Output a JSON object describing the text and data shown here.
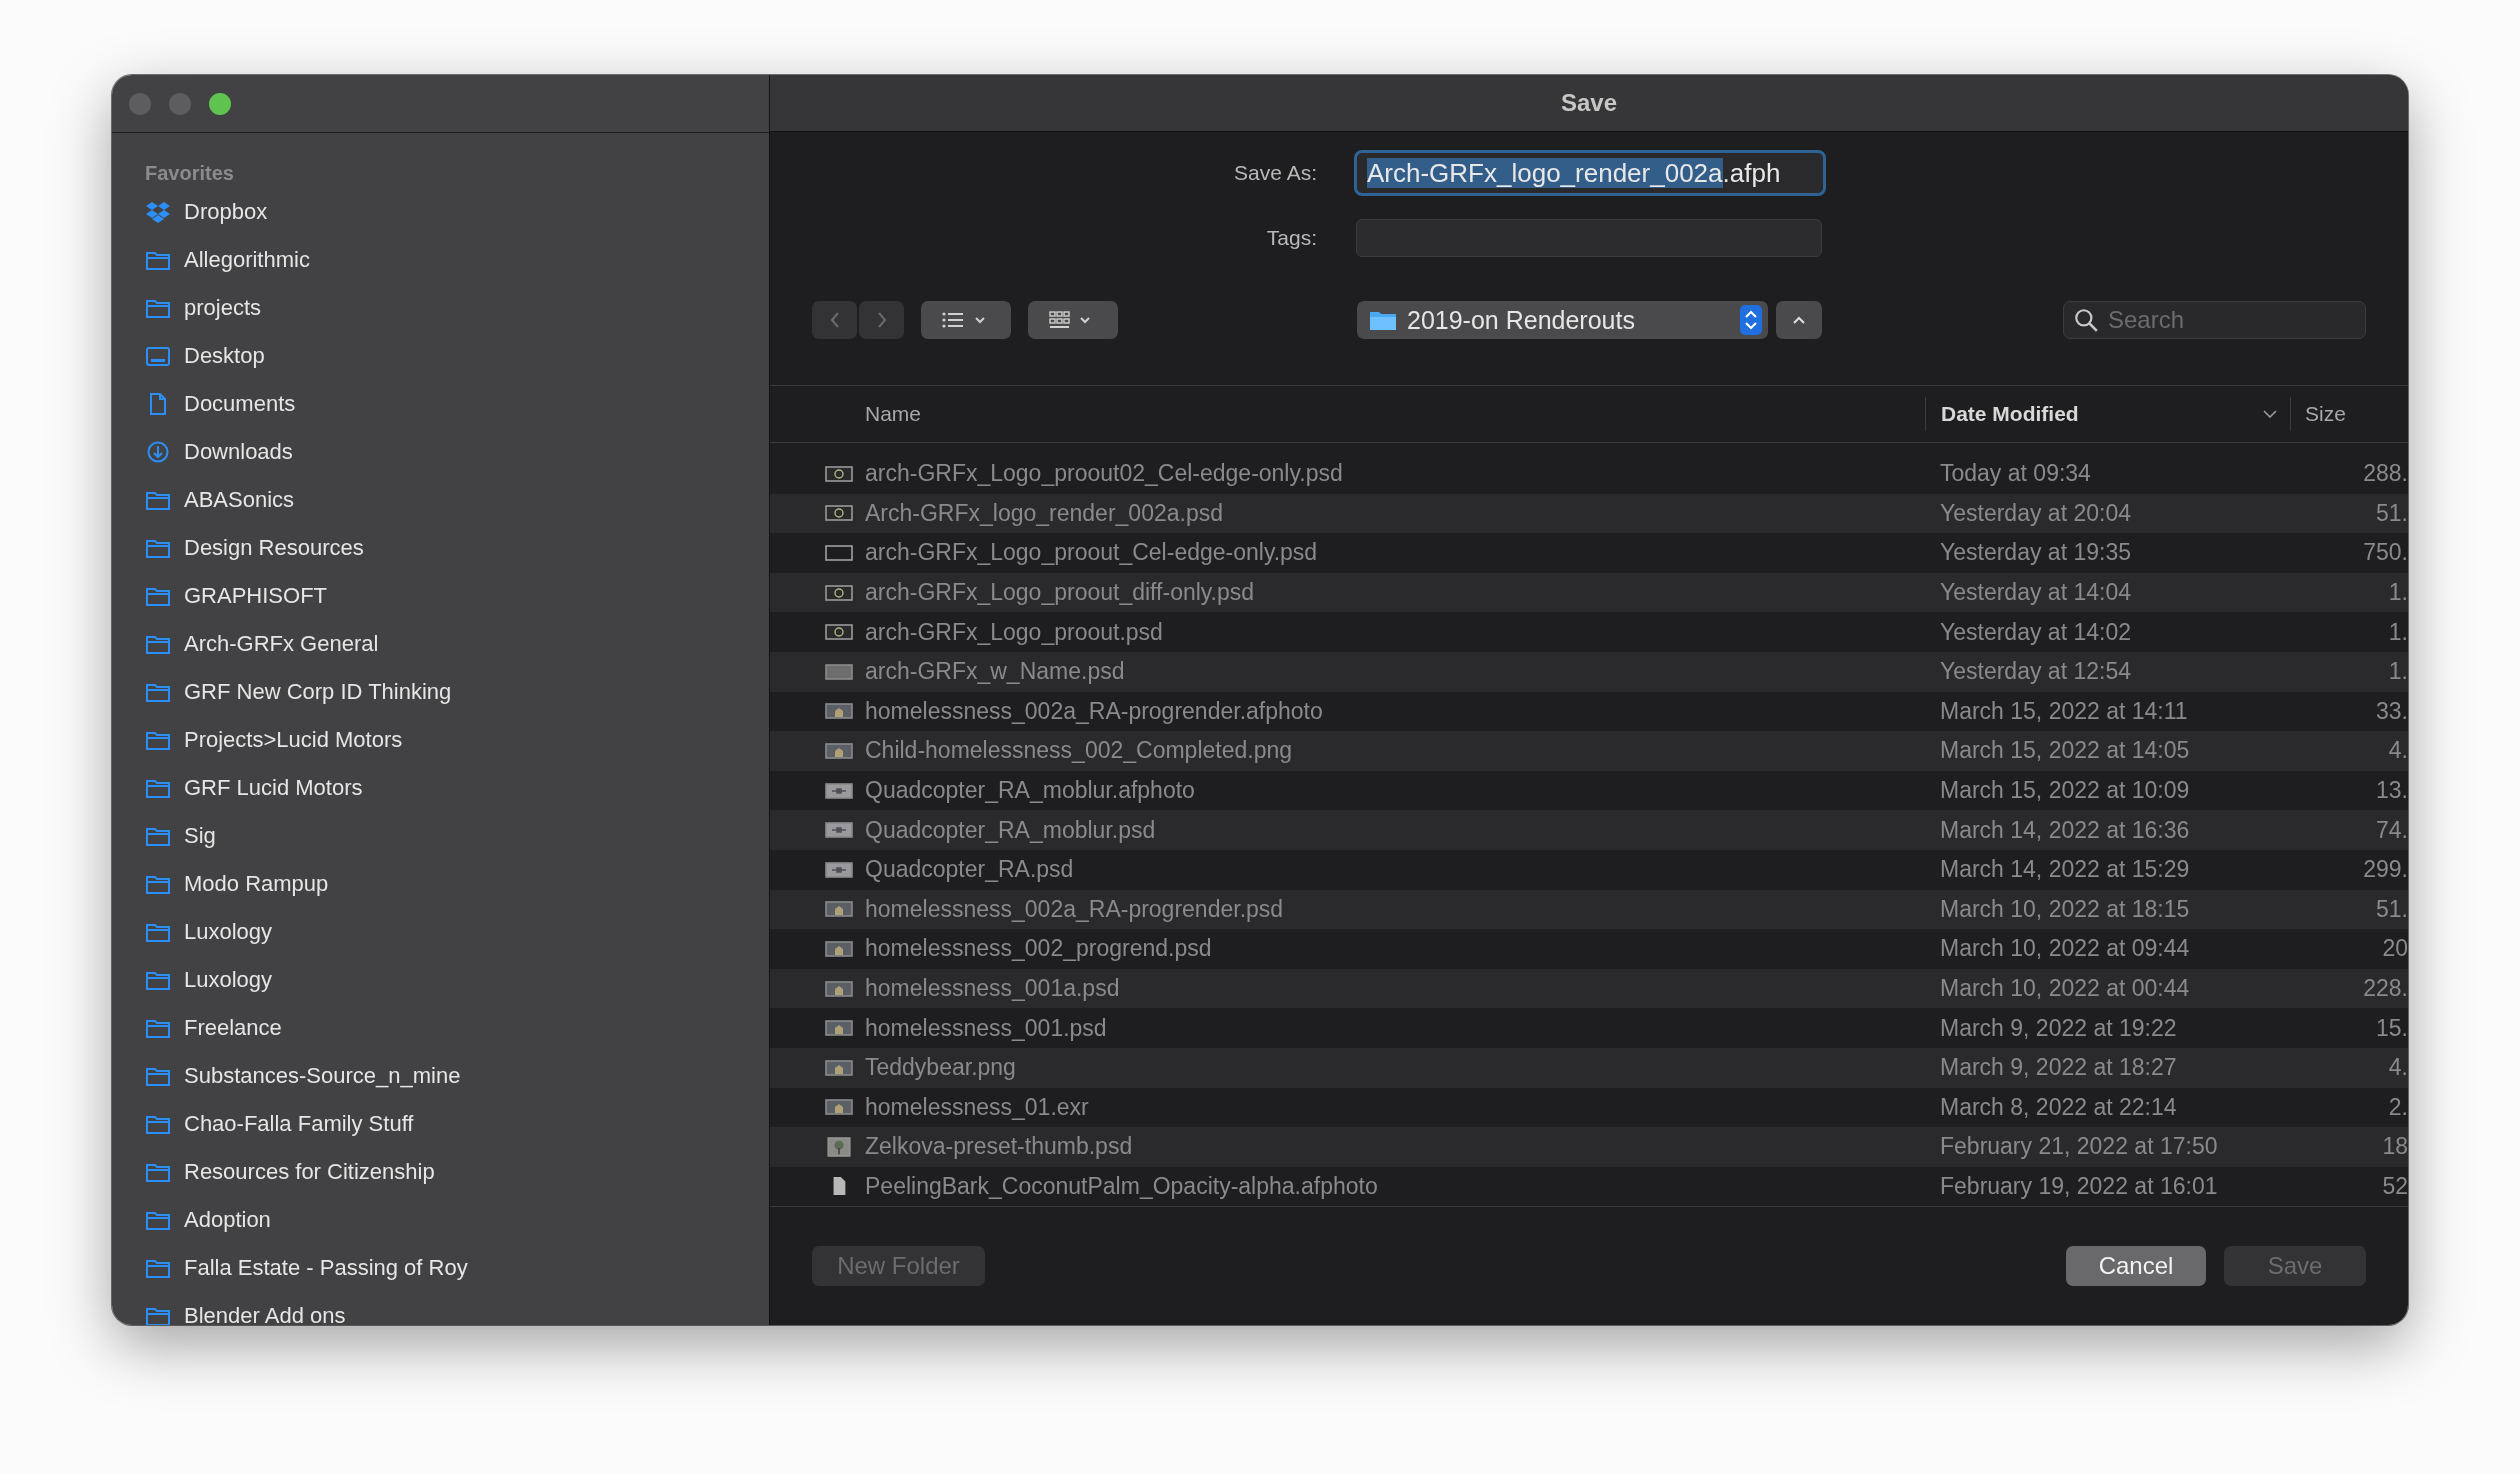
{
  "window": {
    "title": "Save",
    "controls": [
      {
        "color": "#5d5d5f"
      },
      {
        "color": "#5d5d5f"
      },
      {
        "color": "#5fc350"
      }
    ]
  },
  "sidebar": {
    "heading": "Favorites",
    "items": [
      {
        "label": "Dropbox",
        "kind": "dropbox"
      },
      {
        "label": "Allegorithmic",
        "kind": "folder"
      },
      {
        "label": "projects",
        "kind": "folder"
      },
      {
        "label": "Desktop",
        "kind": "desktop"
      },
      {
        "label": "Documents",
        "kind": "document"
      },
      {
        "label": "Downloads",
        "kind": "download"
      },
      {
        "label": "ABASonics",
        "kind": "folder"
      },
      {
        "label": "Design Resources",
        "kind": "folder"
      },
      {
        "label": "GRAPHISOFT",
        "kind": "folder"
      },
      {
        "label": "Arch-GRFx General",
        "kind": "folder"
      },
      {
        "label": "GRF New Corp ID Thinking",
        "kind": "folder"
      },
      {
        "label": "Projects>Lucid Motors",
        "kind": "folder"
      },
      {
        "label": "GRF Lucid Motors",
        "kind": "folder"
      },
      {
        "label": "Sig",
        "kind": "folder"
      },
      {
        "label": "Modo Rampup",
        "kind": "folder"
      },
      {
        "label": "Luxology",
        "kind": "folder"
      },
      {
        "label": "Luxology",
        "kind": "folder"
      },
      {
        "label": "Freelance",
        "kind": "folder"
      },
      {
        "label": "Substances-Source_n_mine",
        "kind": "folder"
      },
      {
        "label": "Chao-Falla Family Stuff",
        "kind": "folder"
      },
      {
        "label": "Resources for Citizenship",
        "kind": "folder"
      },
      {
        "label": "Adoption",
        "kind": "folder"
      },
      {
        "label": "Falla Estate - Passing of Roy",
        "kind": "folder"
      },
      {
        "label": "Blender Add ons",
        "kind": "folder"
      }
    ]
  },
  "form": {
    "save_as": {
      "label": "Save As:",
      "selected_text": "Arch-GRFx_logo_render_002a",
      "rest": ".afph"
    },
    "tags": {
      "label": "Tags:"
    }
  },
  "toolbar": {
    "location": "2019-on Renderouts",
    "search": {
      "placeholder": "Search"
    }
  },
  "table": {
    "columns": [
      {
        "label": "Name",
        "sorted": false
      },
      {
        "label": "Date Modified",
        "sorted": true
      },
      {
        "label": "Size",
        "sorted": false
      }
    ],
    "rows": [
      {
        "name": "arch-GRFx_Logo_proout02_Cel-edge-only.psd",
        "date": "Today at 09:34",
        "size": "288.",
        "kind": "logo"
      },
      {
        "name": "Arch-GRFx_logo_render_002a.psd",
        "date": "Yesterday at 20:04",
        "size": "51.",
        "kind": "logo"
      },
      {
        "name": "arch-GRFx_Logo_proout_Cel-edge-only.psd",
        "date": "Yesterday at 19:35",
        "size": "750.",
        "kind": "blank"
      },
      {
        "name": "arch-GRFx_Logo_proout_diff-only.psd",
        "date": "Yesterday at 14:04",
        "size": "1.",
        "kind": "logo"
      },
      {
        "name": "arch-GRFx_Logo_proout.psd",
        "date": "Yesterday at 14:02",
        "size": "1.",
        "kind": "logo"
      },
      {
        "name": "arch-GRFx_w_Name.psd",
        "date": "Yesterday at 12:54",
        "size": "1.",
        "kind": "plain"
      },
      {
        "name": "homelessness_002a_RA-progrender.afphoto",
        "date": "March 15, 2022 at 14:11",
        "size": "33.",
        "kind": "scene"
      },
      {
        "name": "Child-homelessness_002_Completed.png",
        "date": "March 15, 2022 at 14:05",
        "size": "4.",
        "kind": "scene"
      },
      {
        "name": "Quadcopter_RA_moblur.afphoto",
        "date": "March 15, 2022 at 10:09",
        "size": "13.",
        "kind": "drone"
      },
      {
        "name": "Quadcopter_RA_moblur.psd",
        "date": "March 14, 2022 at 16:36",
        "size": "74.",
        "kind": "drone"
      },
      {
        "name": "Quadcopter_RA.psd",
        "date": "March 14, 2022 at 15:29",
        "size": "299.",
        "kind": "drone"
      },
      {
        "name": "homelessness_002a_RA-progrender.psd",
        "date": "March 10, 2022 at 18:15",
        "size": "51.",
        "kind": "scene"
      },
      {
        "name": "homelessness_002_progrend.psd",
        "date": "March 10, 2022 at 09:44",
        "size": "20",
        "kind": "scene"
      },
      {
        "name": "homelessness_001a.psd",
        "date": "March 10, 2022 at 00:44",
        "size": "228.",
        "kind": "scene"
      },
      {
        "name": "homelessness_001.psd",
        "date": "March 9, 2022 at 19:22",
        "size": "15.",
        "kind": "scene"
      },
      {
        "name": "Teddybear.png",
        "date": "March 9, 2022 at 18:27",
        "size": "4.",
        "kind": "scene"
      },
      {
        "name": "homelessness_01.exr",
        "date": "March 8, 2022 at 22:14",
        "size": "2.",
        "kind": "scene"
      },
      {
        "name": "Zelkova-preset-thumb.psd",
        "date": "February 21, 2022 at 17:50",
        "size": "18",
        "kind": "tree"
      },
      {
        "name": "PeelingBark_CoconutPalm_Opacity-alpha.afphoto",
        "date": "February 19, 2022 at 16:01",
        "size": "52",
        "kind": "document"
      }
    ]
  },
  "buttons": [
    {
      "label": "New Folder",
      "disabled": true
    },
    {
      "label": "Cancel",
      "disabled": false
    },
    {
      "label": "Save",
      "disabled": true
    }
  ]
}
